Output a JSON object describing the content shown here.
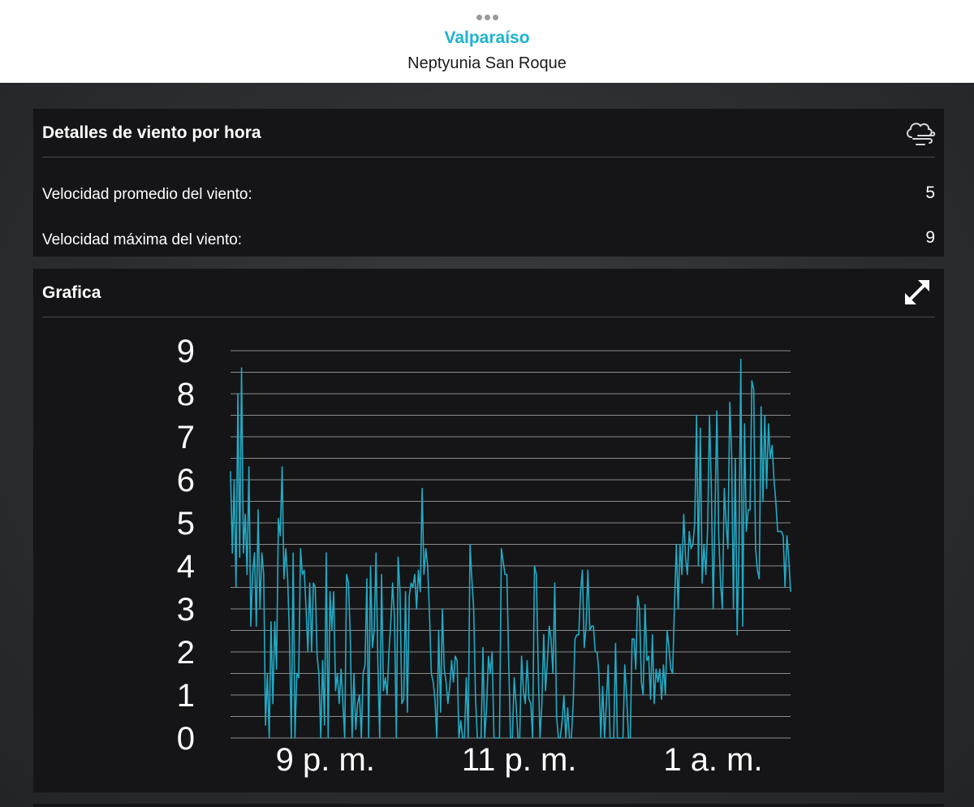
{
  "header": {
    "title": "Valparaíso",
    "subtitle": "Neptyunia San Roque"
  },
  "wind_card": {
    "title": "Detalles de viento por hora",
    "icon": "wind-cloud-icon",
    "rows": [
      {
        "label": "Velocidad promedio del viento:",
        "value": "5"
      },
      {
        "label": "Velocidad máxima del viento:",
        "value": "9"
      }
    ]
  },
  "chart_card": {
    "title": "Grafica",
    "icon": "expand-icon"
  },
  "colors": {
    "accent": "#1db3d1",
    "line": "#22aac4",
    "card": "#151517",
    "background": "#2a2c2f"
  },
  "chart_data": {
    "type": "line",
    "title": "",
    "xlabel": "",
    "ylabel": "",
    "ylim": [
      0,
      9
    ],
    "xlim": [
      0,
      260
    ],
    "y_ticks": [
      "0",
      "1",
      "2",
      "3",
      "4",
      "5",
      "6",
      "7",
      "8",
      "9"
    ],
    "x_ticks": [
      {
        "x": 44,
        "label": "9 p. m."
      },
      {
        "x": 134,
        "label": "11 p. m."
      },
      {
        "x": 224,
        "label": "1 a. m."
      }
    ],
    "grid": true,
    "series": [
      {
        "values": [
          6.2,
          4.3,
          6.0,
          3.5,
          8.0,
          4.2,
          8.6,
          4.3,
          5.2,
          3.8,
          6.3,
          2.6,
          3.8,
          4.3,
          2.6,
          5.3,
          3.0,
          4.3,
          3.8,
          0.3,
          1.5,
          0.0,
          2.7,
          0.8,
          2.7,
          1.6,
          5.1,
          4.7,
          6.3,
          3.7,
          4.4,
          3.7,
          2.4,
          0.0,
          4.3,
          0.0,
          1.5,
          1.4,
          4.4,
          3.8,
          3.9,
          3.0,
          2.0,
          3.6,
          2.0,
          3.6,
          3.5,
          1.9,
          1.5,
          0.0,
          1.8,
          0.3,
          4.3,
          0.0,
          3.4,
          2.5,
          3.4,
          1.1,
          1.5,
          0.8,
          1.6,
          0.8,
          0.0,
          3.8,
          3.6,
          2.4,
          0.0,
          1.5,
          0.2,
          0.8,
          1.0,
          0.0,
          1.5,
          1.7,
          3.7,
          0.0,
          4.0,
          2.1,
          2.5,
          4.3,
          1.7,
          0.0,
          3.8,
          1.1,
          1.4,
          1.0,
          2.0,
          2.7,
          3.6,
          2.8,
          0.0,
          4.2,
          3.4,
          0.8,
          0.9,
          3.4,
          0.6,
          3.3,
          3.6,
          3.5,
          3.8,
          3.0,
          3.9,
          3.4,
          5.8,
          3.8,
          4.4,
          4.0,
          2.9,
          1.5,
          1.3,
          0.9,
          0.0,
          2.5,
          0.6,
          3.0,
          1.6,
          1.3,
          0.8,
          1.2,
          1.8,
          1.3,
          1.9,
          1.8,
          0.0,
          0.4,
          0.0,
          0.0,
          1.4,
          0.0,
          4.5,
          3.7,
          3.0,
          0.9,
          0.0,
          0.0,
          0.0,
          2.1,
          0.0,
          0.7,
          1.9,
          1.5,
          2.0,
          0.0,
          0.0,
          0.0,
          0.0,
          4.4,
          4.1,
          3.8,
          3.8,
          1.8,
          0.0,
          0.0,
          1.4,
          0.8,
          0.0,
          0.0,
          1.9,
          1.1,
          0.8,
          1.8,
          0.9,
          0.8,
          0.0,
          4.0,
          3.8,
          1.7,
          0.0,
          0.8,
          2.4,
          1.1,
          1.8,
          2.6,
          2.3,
          1.5,
          3.6,
          0.5,
          0.0,
          0.0,
          0.4,
          1.0,
          0.0,
          0.7,
          0.0,
          0.0,
          0.8,
          2.3,
          2.4,
          2.4,
          3.4,
          3.9,
          2.1,
          2.6,
          3.9,
          2.5,
          2.6,
          2.6,
          2.0,
          2.0,
          1.5,
          0.0,
          1.2,
          0.0,
          0.8,
          1.7,
          0.0,
          0.0,
          0.0,
          2.2,
          0.0,
          0.0,
          0.0,
          0.0,
          1.7,
          1.0,
          0.0,
          0.0,
          2.3,
          2.3,
          1.6,
          3.3,
          3.0,
          1.3,
          1.0,
          3.1,
          1.8,
          1.9,
          0.9,
          2.4,
          0.8,
          1.6,
          1.3,
          1.6,
          0.9,
          1.7,
          1.0,
          2.5,
          2.1,
          1.6,
          1.5,
          3.1,
          4.5,
          3.0,
          4.5,
          3.8,
          5.2,
          4.2,
          3.8,
          4.8,
          4.4,
          4.5,
          5.0,
          7.5,
          4.0,
          7.2,
          3.6,
          4.5,
          3.8,
          4.9,
          7.5,
          5.8,
          3.0,
          5.2,
          7.6,
          4.7,
          3.6,
          3.0,
          5.8,
          5.0,
          4.4,
          7.8,
          6.6,
          3.0,
          6.5,
          2.4,
          4.3,
          8.8,
          2.6,
          7.3,
          4.8,
          5.3,
          5.3,
          8.3,
          8.1,
          4.4,
          3.9,
          3.7,
          7.7,
          5.5,
          7.5,
          5.8,
          7.3,
          6.5,
          6.8,
          6.0,
          5.5,
          4.8,
          4.8,
          4.8,
          4.7,
          3.5,
          4.7,
          4.2,
          3.4
        ]
      }
    ]
  }
}
